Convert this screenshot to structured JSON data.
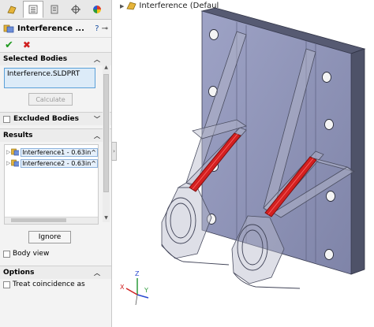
{
  "panel": {
    "title": "Interference ...",
    "help_icon": "?",
    "selected_bodies": {
      "header": "Selected Bodies",
      "items": [
        "Interference.SLDPRT"
      ],
      "calculate_label": "Calculate"
    },
    "excluded_bodies": {
      "label": "Excluded Bodies"
    },
    "results": {
      "header": "Results",
      "items": [
        {
          "label": "Interference1 - 0.63in^"
        },
        {
          "label": "Interference2 - 0.63in^"
        }
      ],
      "ignore_label": "Ignore"
    },
    "body_view_label": "Body view",
    "options": {
      "header": "Options",
      "treat_coincidence_label": "Treat coincidence as"
    }
  },
  "tree": {
    "root_label": "Interference  (Defaul"
  },
  "triad": {
    "x": "X",
    "y": "Y",
    "z": "Z"
  },
  "colors": {
    "interference": "#d32020",
    "part": "#8f94b8",
    "selection": "#dcebf8"
  }
}
